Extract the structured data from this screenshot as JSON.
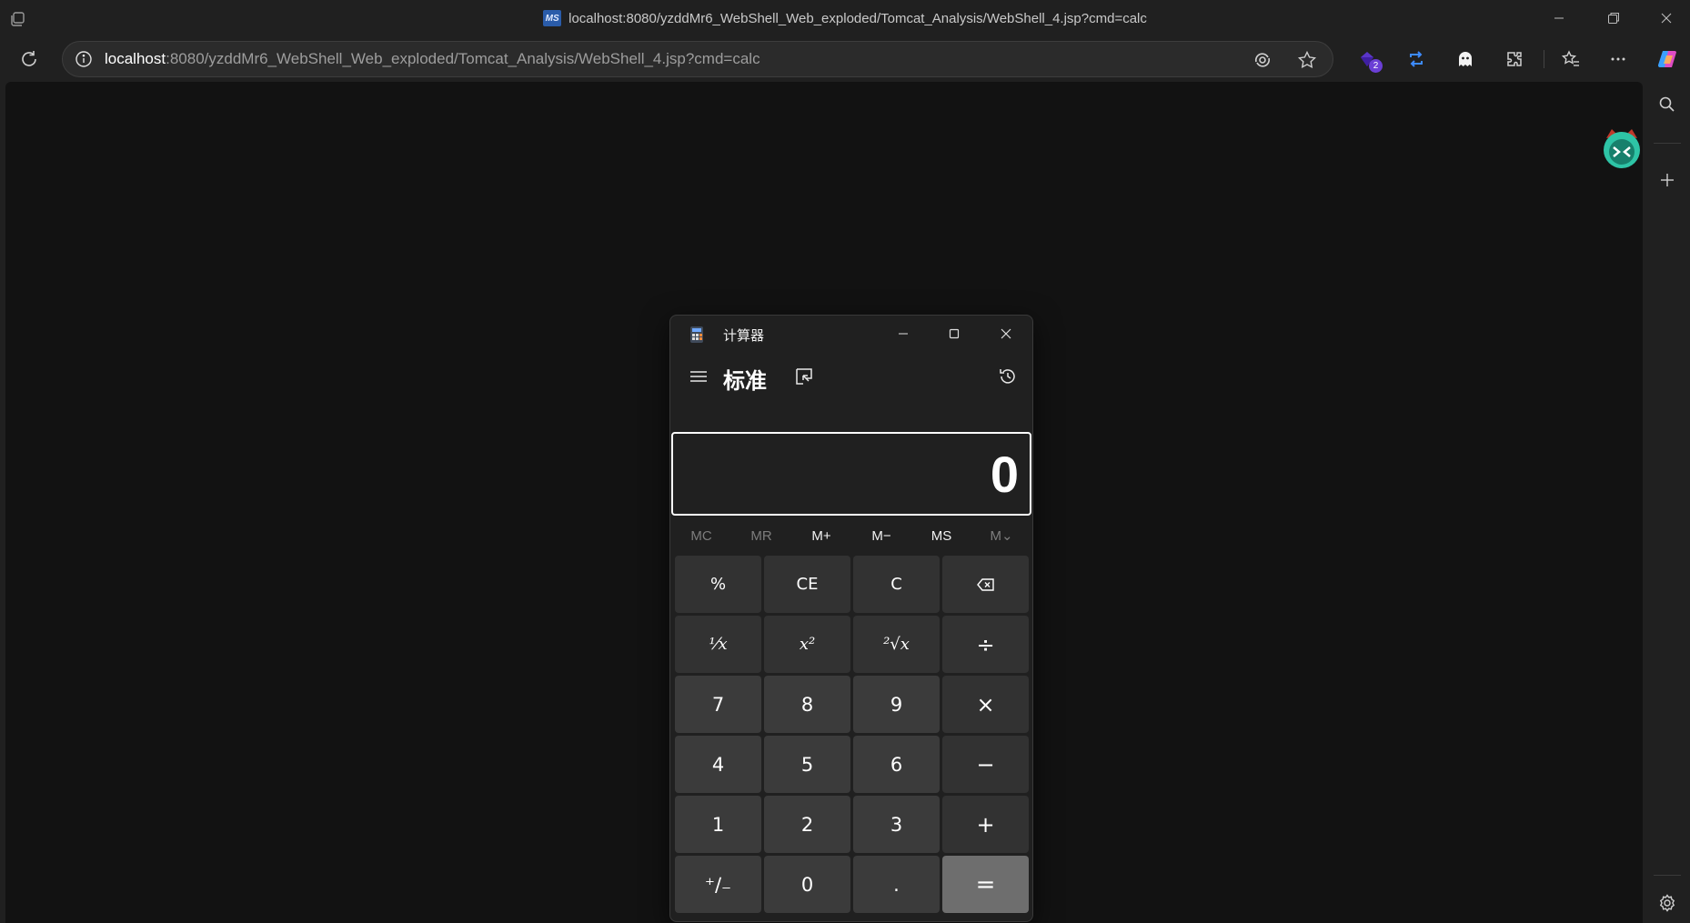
{
  "browser": {
    "window_title": "localhost:8080/yzddMr6_WebShell_Web_exploded/Tomcat_Analysis/WebShell_4.jsp?cmd=calc",
    "favicon_text": "MS",
    "url_host": "localhost",
    "url_rest": ":8080/yzddMr6_WebShell_Web_exploded/Tomcat_Analysis/WebShell_4.jsp?cmd=calc",
    "extension_badge": "2",
    "accent_color": "#6b3fd6"
  },
  "calculator": {
    "title": "计算器",
    "mode": "标准",
    "display_value": "0",
    "memory": [
      {
        "label": "MC",
        "enabled": false
      },
      {
        "label": "MR",
        "enabled": false
      },
      {
        "label": "M+",
        "enabled": true
      },
      {
        "label": "M−",
        "enabled": true
      },
      {
        "label": "MS",
        "enabled": true
      },
      {
        "label": "M⌄",
        "enabled": false
      }
    ],
    "keys": {
      "percent": "%",
      "ce": "CE",
      "c": "C",
      "reciprocal": "⅟x",
      "square": "x²",
      "sqrt": "²√x",
      "divide": "÷",
      "seven": "7",
      "eight": "8",
      "nine": "9",
      "multiply": "×",
      "four": "4",
      "five": "5",
      "six": "6",
      "minus": "−",
      "one": "1",
      "two": "2",
      "three": "3",
      "plus": "+",
      "negate": "⁺∕₋",
      "zero": "0",
      "decimal": ".",
      "equals": "="
    }
  }
}
